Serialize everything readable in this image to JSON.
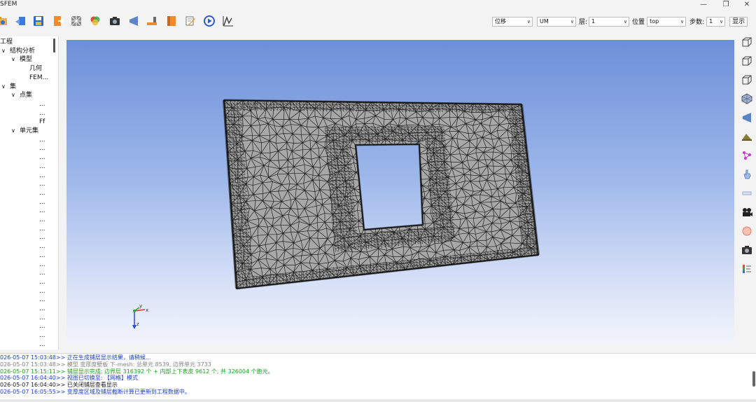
{
  "window": {
    "title": "SFEM",
    "minimize_glyph": "—",
    "restore_glyph": "❐",
    "close_glyph": "✕"
  },
  "toolbar": {
    "icons": [
      "open-folder-icon",
      "import-icon",
      "save-icon",
      "export-icon",
      "mesh-view-icon",
      "color-map-icon",
      "camera-icon",
      "plane-icon",
      "measure-icon",
      "material-icon",
      "edit-icon",
      "play-icon",
      "curve-icon"
    ],
    "result_type": "位移",
    "component": "UM",
    "layer_label": "层:",
    "layer_value": "1",
    "position_label": "位置",
    "position_value": "top",
    "step_label": "步数:",
    "step_value": "1",
    "show_button": "显示"
  },
  "tree": {
    "items": [
      {
        "label": "工程"
      },
      {
        "label": "结构分析",
        "toggle": "∨"
      },
      {
        "label": "模型",
        "toggle": "∨"
      },
      {
        "label": "几何"
      },
      {
        "label": "FEM..."
      },
      {
        "label": "集",
        "toggle": "∨"
      },
      {
        "label": "点集",
        "toggle": "∨"
      },
      {
        "label": "..."
      },
      {
        "label": "..."
      },
      {
        "label": "Ff"
      },
      {
        "label": "单元集",
        "toggle": "∨"
      },
      {
        "label": "..."
      },
      {
        "label": "..."
      },
      {
        "label": "..."
      },
      {
        "label": "..."
      },
      {
        "label": "..."
      },
      {
        "label": "..."
      },
      {
        "label": "..."
      },
      {
        "label": "..."
      },
      {
        "label": "..."
      },
      {
        "label": "..."
      },
      {
        "label": "..."
      },
      {
        "label": "..."
      },
      {
        "label": "..."
      },
      {
        "label": "..."
      },
      {
        "label": "..."
      },
      {
        "label": "..."
      },
      {
        "label": "..."
      },
      {
        "label": "..."
      },
      {
        "label": "..."
      },
      {
        "label": "..."
      },
      {
        "label": "..."
      },
      {
        "label": "..."
      },
      {
        "label": "..."
      },
      {
        "label": "..."
      },
      {
        "label": "..."
      }
    ]
  },
  "viewport": {
    "axis_x": "x",
    "axis_y": "y",
    "axis_z": "z"
  },
  "right_tools": {
    "icons": [
      "iso-view-icon",
      "wireframe-view-icon",
      "front-view-icon",
      "lattice-icon",
      "section-plane-icon",
      "layer-icon",
      "node-select-icon",
      "hand-select-icon",
      "ruler-icon",
      "video-camera-icon",
      "material-sphere-icon",
      "screenshot-icon",
      "legend-icon"
    ]
  },
  "log": {
    "lines": [
      {
        "text": "026-05-07 15:03:48>> 正在生成铺层显示结果，请稍候...",
        "color": "#1a3fc4"
      },
      {
        "text": "026-05-07 15:03:48>> 模型 变厚度壁板 下-mesh: 总单元 8539, 边界单元 3733",
        "color": "#808080"
      },
      {
        "text": "026-05-07 15:15:11>> 铺层显示完成: 边界层 316392 个 + 内部上下表皮 9612 个, 共 326004 个胞元。",
        "color": "#18a21c"
      },
      {
        "text": "026-05-07 16:04:40>> 视图已切换至: 【网格】模式",
        "color": "#1a3fc4"
      },
      {
        "text": "026-05-07 16:04:40>> 已关闭铺层查看显示",
        "color": "#1a1a1a"
      },
      {
        "text": "026-05-07 16:05:55>> 变厚度区域及铺层截断计算已更新到工程数据中。",
        "color": "#1a3fc4"
      }
    ]
  },
  "colors": {
    "mesh_fill": "#a8a8a8",
    "mesh_line": "#1e1e1e",
    "viewport_top": "#6d8fd8",
    "viewport_bottom": "#f2f4fb"
  }
}
